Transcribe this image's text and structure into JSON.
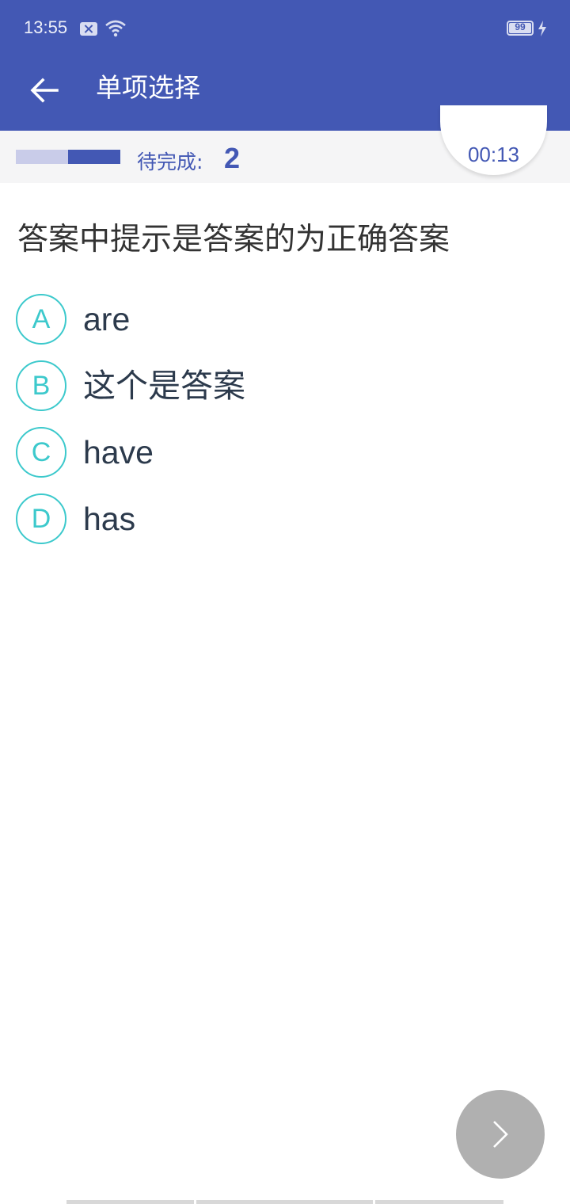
{
  "status_bar": {
    "time": "13:55",
    "battery": "99",
    "icons": [
      "notification-blocked-icon",
      "wifi-icon",
      "battery-icon",
      "charging-icon"
    ]
  },
  "app_bar": {
    "title": "单项选择",
    "back_icon": "arrow-left-icon"
  },
  "progress": {
    "pending_label": "待完成:",
    "pending_count": "2",
    "completed_fraction": 0.5,
    "timer": "00:13"
  },
  "question": {
    "text": "答案中提示是答案的为正确答案"
  },
  "options": [
    {
      "letter": "A",
      "text": "are"
    },
    {
      "letter": "B",
      "text": "这个是答案"
    },
    {
      "letter": "C",
      "text": "have"
    },
    {
      "letter": "D",
      "text": "has"
    }
  ],
  "next_button": {
    "icon": "chevron-right-icon"
  },
  "colors": {
    "primary": "#4358b4",
    "accent": "#3cc9cc",
    "progress_track": "#c9cce9",
    "next_button_bg": "#b0b0b0"
  }
}
